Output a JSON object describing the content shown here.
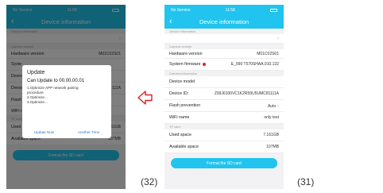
{
  "status": {
    "carrier": "No Service",
    "time": "11:58"
  },
  "nav": {
    "title": "Device information",
    "back_glyph": "‹"
  },
  "sections": {
    "device_info": "Device Information",
    "camera_version": "Camera version",
    "camera_info": "Camera information",
    "tf_card": "TF card"
  },
  "rows": {
    "hardware_label": "Hardware version",
    "hardware_value": "M01C02S01",
    "system_fw_label": "System firmware",
    "system_fw_value": "E_990 T570SHAA.010.132",
    "device_model_label": "Device model",
    "device_id_label": "Device ID:",
    "device_id_value": "Z99J6100VC1K2R59U5UMC81111A",
    "flash_label": "Flash prevention",
    "flash_value": "Auto",
    "wifi_label": "WiFi name",
    "wifi_value": "only test",
    "used_label": "Used space",
    "used_value": "7.161GB",
    "available_label": "Available space",
    "available_value": "107MB",
    "chevron": "›"
  },
  "format_button": "Format the SD card",
  "left_partial": {
    "system": "Syste",
    "device": "Device",
    "device2": "Device",
    "flash": "Flash",
    "wifi": "WiFi n",
    "device_id_tail": "111A"
  },
  "dialog": {
    "title": "Update",
    "subtitle": "Can Update to 00.00.00.01",
    "line1": "1.Optimize APP network pairing",
    "line2": "procedure",
    "line3": "2.Optimize...",
    "line4": "3.Optimize...",
    "update_now": "Update Now",
    "another_time": "Another Time"
  },
  "captions": {
    "left": "(32)",
    "right": "(31)"
  },
  "colors": {
    "accent": "#20c4ee",
    "dot": "#e02020",
    "arrow": "#e02020"
  }
}
